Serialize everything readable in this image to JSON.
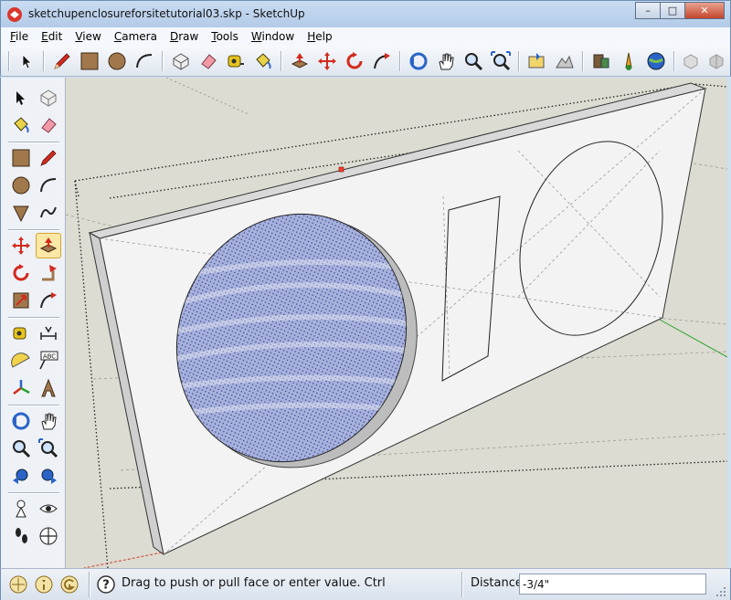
{
  "window": {
    "title": "sketchupenclosureforsitetutorial03.skp - SketchUp",
    "controls": {
      "minimize": "–",
      "maximize": "□",
      "close": "✕"
    }
  },
  "menubar": {
    "items": [
      {
        "label": "File"
      },
      {
        "label": "Edit"
      },
      {
        "label": "View"
      },
      {
        "label": "Camera"
      },
      {
        "label": "Draw"
      },
      {
        "label": "Tools"
      },
      {
        "label": "Window"
      },
      {
        "label": "Help"
      }
    ]
  },
  "toolbar": {
    "buttons": [
      "select-icon",
      "pencil-icon",
      "rectangle-icon",
      "circle-icon",
      "arc-icon",
      "make-component-icon",
      "eraser-icon",
      "tape-measure-icon",
      "paint-bucket-icon",
      "push-pull-icon",
      "move-icon",
      "rotate-icon",
      "follow-me-icon",
      "orbit-icon",
      "pan-icon",
      "zoom-icon",
      "zoom-extents-icon",
      "add-location-icon",
      "toggle-terrain-icon",
      "photo-textures-icon",
      "preview-google-earth-icon",
      "get-models-icon",
      "share-model-icon",
      "share-component-icon",
      "extension-warehouse-icon"
    ]
  },
  "sidebar": {
    "tools": [
      "select-icon",
      "make-component-icon",
      "paint-bucket-icon",
      "eraser-icon",
      "rectangle-icon",
      "pencil-icon",
      "circle-icon",
      "arc-icon",
      "polygon-icon",
      "freehand-icon",
      "move-icon",
      "push-pull-icon",
      "rotate-icon",
      "follow-me-icon",
      "scale-icon",
      "offset-icon",
      "tape-measure-icon",
      "dimension-icon",
      "protractor-icon",
      "text-icon",
      "axes-icon",
      "3d-text-icon",
      "orbit-icon",
      "pan-icon",
      "zoom-icon",
      "zoom-window-icon",
      "previous-view-icon",
      "next-view-icon",
      "position-camera-icon",
      "look-around-icon",
      "walk-icon",
      "section-plane-icon"
    ],
    "text_label": "ABC"
  },
  "statusbar": {
    "message": "Drag to push or pull face or enter value.  Ctrl = tc",
    "help_glyph": "?",
    "vcb_label": "Distance",
    "vcb_value": "-3/4\""
  },
  "colors": {
    "viewport_background": "#dcdcd2",
    "panel_face": "#f2f2f2",
    "selected_face": "#9aa6d8",
    "axis_red": "#d23a2a",
    "axis_green": "#2aa02a"
  }
}
